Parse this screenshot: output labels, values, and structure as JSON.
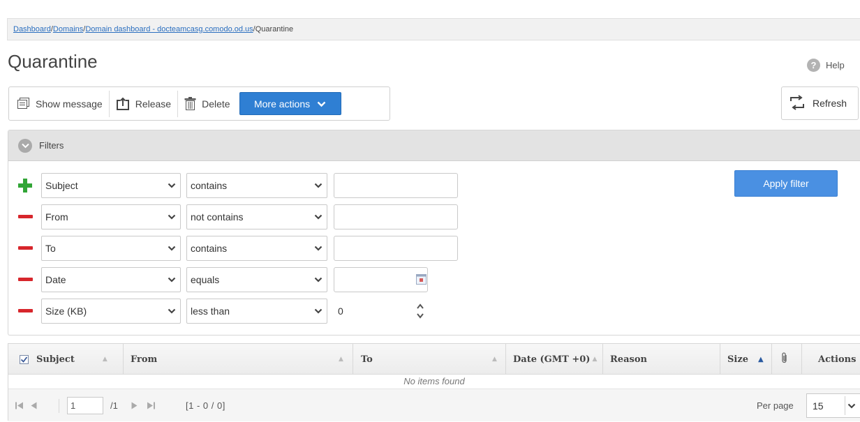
{
  "breadcrumb": {
    "links": [
      "Dashboard",
      "Domains",
      "Domain dashboard - docteamcasg.comodo.od.us"
    ],
    "current": "Quarantine",
    "separator": " / "
  },
  "page": {
    "title": "Quarantine",
    "help_label": "Help"
  },
  "toolbar": {
    "show_message": "Show message",
    "release": "Release",
    "delete": "Delete",
    "more_actions": "More actions",
    "refresh": "Refresh"
  },
  "filters": {
    "title": "Filters",
    "apply_label": "Apply filter",
    "rows": [
      {
        "sign": "add",
        "field": "Subject",
        "operator": "contains",
        "value": ""
      },
      {
        "sign": "remove",
        "field": "From",
        "operator": "not contains",
        "value": ""
      },
      {
        "sign": "remove",
        "field": "To",
        "operator": "contains",
        "value": ""
      },
      {
        "sign": "remove",
        "field": "Date",
        "operator": "equals",
        "value": ""
      },
      {
        "sign": "remove",
        "field": "Size (KB)",
        "operator": "less than",
        "value": "0"
      }
    ]
  },
  "grid": {
    "columns": {
      "subject": "Subject",
      "from": "From",
      "to": "To",
      "date": "Date (GMT +0)",
      "reason": "Reason",
      "size": "Size",
      "actions": "Actions"
    },
    "select_all_checked": true,
    "empty_text": "No items found"
  },
  "pager": {
    "page_value": "1",
    "page_total": "/1",
    "range": "[1 - 0 / 0]",
    "per_page_label": "Per page",
    "per_page_value": "15"
  },
  "colors": {
    "primary_button": "#2f7fd3",
    "apply_button": "#4a90e2",
    "add_icon": "#31a536",
    "remove_icon": "#d7262c",
    "link": "#2a6ebf"
  }
}
